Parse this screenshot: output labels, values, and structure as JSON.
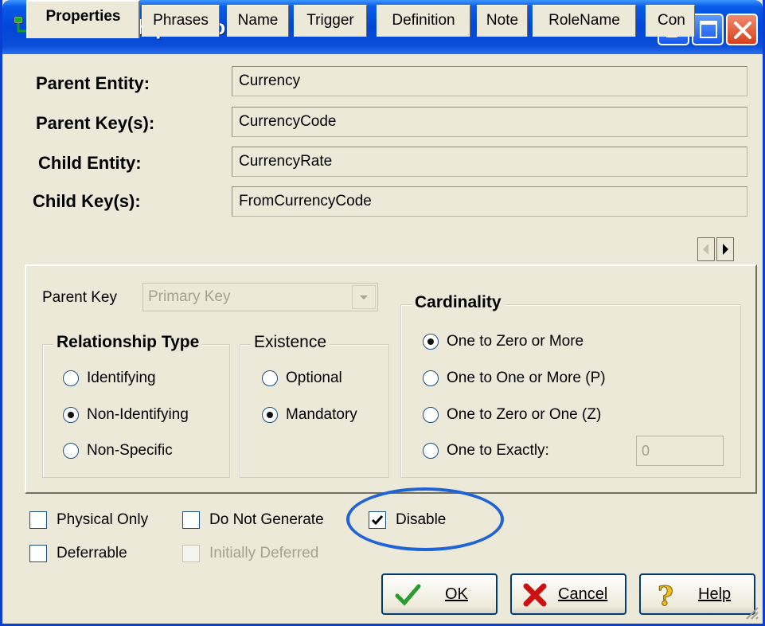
{
  "window": {
    "title": "Relationship Editor",
    "title_icon": "relationship-icon"
  },
  "header_fields": [
    {
      "label": "Parent Entity:",
      "value": "Currency"
    },
    {
      "label": "Parent Key(s):",
      "value": "CurrencyCode"
    },
    {
      "label": "Child Entity:",
      "value": "CurrencyRate"
    },
    {
      "label": "Child Key(s):",
      "value": "FromCurrencyCode"
    }
  ],
  "tabs": [
    {
      "label": "Properties",
      "active": true
    },
    {
      "label": "Phrases"
    },
    {
      "label": "Name"
    },
    {
      "label": "Trigger"
    },
    {
      "label": "Definition"
    },
    {
      "label": "Note"
    },
    {
      "label": "RoleName"
    },
    {
      "label": "Con"
    }
  ],
  "properties": {
    "parent_key_label": "Parent Key",
    "parent_key_value": "Primary Key",
    "relationship_type": {
      "title": "Relationship Type",
      "options": [
        "Identifying",
        "Non-Identifying",
        "Non-Specific"
      ],
      "selected": "Non-Identifying"
    },
    "existence": {
      "title": "Existence",
      "options": [
        "Optional",
        "Mandatory"
      ],
      "selected": "Mandatory"
    },
    "cardinality": {
      "title": "Cardinality",
      "options": [
        "One to Zero or More",
        "One to One or More (P)",
        "One to Zero or One (Z)",
        "One to Exactly:"
      ],
      "selected": "One to Zero or More",
      "exactly_value": "0"
    }
  },
  "options": {
    "physical_only": {
      "label": "Physical Only",
      "checked": false
    },
    "do_not_generate": {
      "label": "Do Not Generate",
      "checked": false
    },
    "disable": {
      "label": "Disable",
      "checked": true
    },
    "deferrable": {
      "label": "Deferrable",
      "checked": false
    },
    "initially_deferred": {
      "label": "Initially Deferred",
      "checked": false,
      "disabled": true
    }
  },
  "buttons": {
    "ok": "OK",
    "cancel": "Cancel",
    "help": "Help"
  },
  "colors": {
    "titlebar": "#0046d8",
    "dialog_bg": "#ece9d8",
    "highlight": "#1f63d6"
  }
}
